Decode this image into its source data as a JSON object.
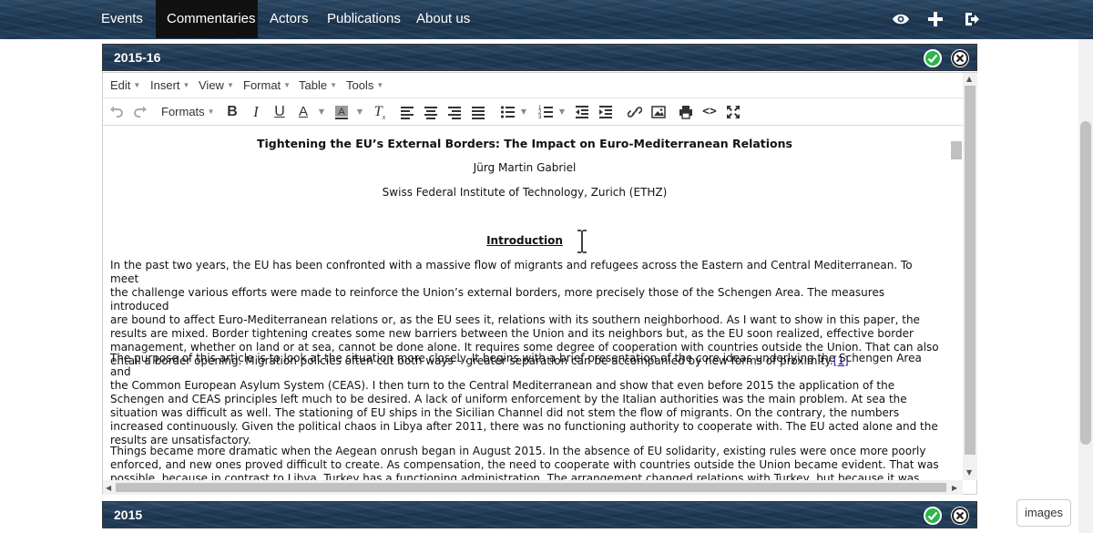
{
  "nav": {
    "items": [
      {
        "label": "Events",
        "active": false
      },
      {
        "label": "Commentaries",
        "active": true
      },
      {
        "label": "Actors",
        "active": false
      },
      {
        "label": "Publications",
        "active": false
      },
      {
        "label": "About us",
        "active": false
      }
    ],
    "icons": [
      "eye-icon",
      "plus-icon",
      "logout-icon"
    ]
  },
  "panels": {
    "current": {
      "title": "2015-16"
    },
    "next": {
      "title": "2015"
    }
  },
  "editor": {
    "menu": [
      "Edit",
      "Insert",
      "View",
      "Format",
      "Table",
      "Tools"
    ],
    "formats_label": "Formats",
    "toolbar_icons": [
      "undo-icon",
      "redo-icon",
      "bold-icon",
      "italic-icon",
      "underline-icon",
      "text-color-icon",
      "background-color-icon",
      "clear-formatting-icon",
      "align-left-icon",
      "align-center-icon",
      "align-right-icon",
      "justify-icon",
      "bullet-list-icon",
      "numbered-list-icon",
      "outdent-icon",
      "indent-icon",
      "link-icon",
      "image-icon",
      "print-icon",
      "source-code-icon",
      "fullscreen-icon"
    ]
  },
  "article": {
    "title": "Tightening the EU’s External Borders: The Impact on Euro-Mediterranean Relations",
    "author": "Jürg Martin Gabriel",
    "institution": "Swiss Federal Institute of Technology, Zurich (ETHZ)",
    "intro_heading": "Introduction",
    "paragraphs": [
      {
        "lines": [
          "In the past two years, the EU has been confronted with a massive flow of migrants and refugees across the Eastern and Central Mediterranean. To meet",
          "the challenge various efforts were made to reinforce the Union’s external borders, more precisely those of the Schengen Area. The measures introduced",
          "are bound to affect Euro-Mediterranean relations or, as the EU sees it, relations with its southern neighborhood. As I want to show in this paper, the",
          "results are mixed. Border tightening creates some new barriers between the Union and its neighbors but, as the EU soon realized, effective border",
          "management, whether on land or at sea, cannot be done alone. It requires some degree of cooperation with countries outside the Union. That can also",
          "entail a border opening. Migration policies often cut both ways – greater separation can be accompanied by new forms of proximity."
        ],
        "footnote": "[1]"
      },
      {
        "lines": [
          "The purpose of this article is to look at the situation more closely. It begins with a brief presentation of the core ideas underlying the Schengen Area and",
          "the Common European Asylum System (CEAS). I then turn to the Central Mediterranean and show that even before 2015 the application of the",
          "Schengen and CEAS principles left much to be desired. A lack of uniform enforcement by the Italian authorities was the main problem. At sea the",
          "situation was difficult as well. The stationing of EU ships in the Sicilian Channel did not stem the flow of migrants. On the contrary, the numbers",
          "increased continuously. Given the political chaos in Libya after 2011, there was no functioning authority to cooperate with. The EU acted alone and the",
          "results are unsatisfactory."
        ]
      },
      {
        "lines": [
          "Things became more dramatic when the Aegean onrush began in August 2015. In the absence of EU solidarity, existing rules were once more poorly",
          "enforced, and new ones proved difficult to create. As compensation, the need to cooperate with countries outside the Union became evident. That was",
          "possible, because in contrast to Libya, Turkey has a functioning administration. The arrangement changed relations with Turkey, but because it was"
        ]
      }
    ]
  },
  "images_button": "images",
  "colors": {
    "accent_green": "#2db54a",
    "active_nav": "#111111"
  }
}
